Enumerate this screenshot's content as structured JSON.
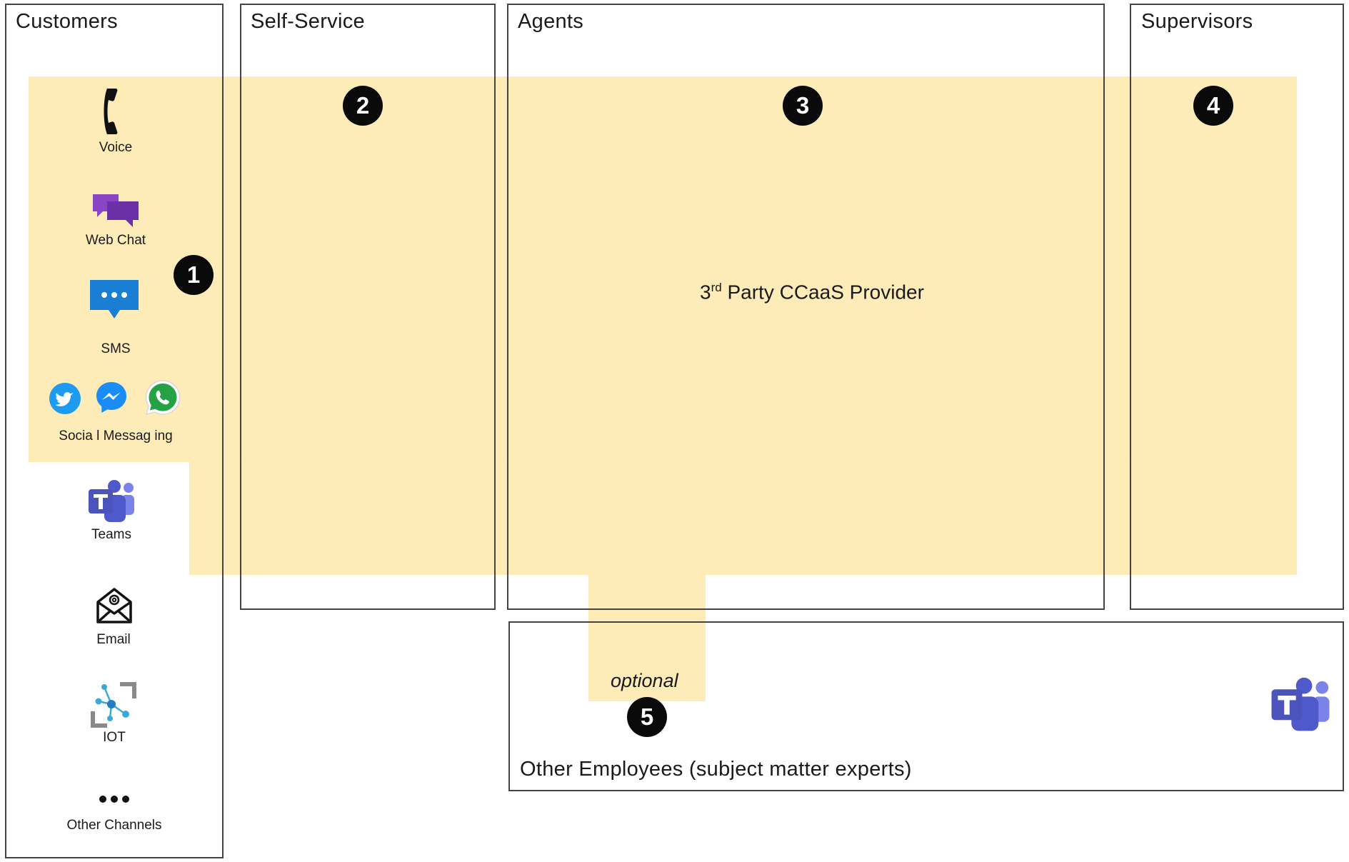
{
  "sections": {
    "customers": "Customers",
    "self_service": "Self-Service",
    "agents": "Agents",
    "supervisors": "Supervisors",
    "other_employees": "Other Employees (subject matter experts)"
  },
  "badges": [
    "1",
    "2",
    "3",
    "4",
    "5"
  ],
  "center": {
    "ordinal": "3",
    "superscript": "rd",
    "rest": " Party CCaaS Provider"
  },
  "optional_label": "optional",
  "channels": {
    "voice": "Voice",
    "web_chat": "Web Chat",
    "sms": "SMS",
    "social_messaging": "Socia l Messag ing",
    "teams": "Teams",
    "email": "Email",
    "iot": "IOT",
    "other_channels": "Other Channels"
  },
  "colors": {
    "highlight": "#fde9b3",
    "teams": "#5059c9",
    "sms": "#1a7fd4",
    "web_chat": "#7b33b5",
    "twitter": "#1d9bf0",
    "whatsapp": "#25a244"
  }
}
